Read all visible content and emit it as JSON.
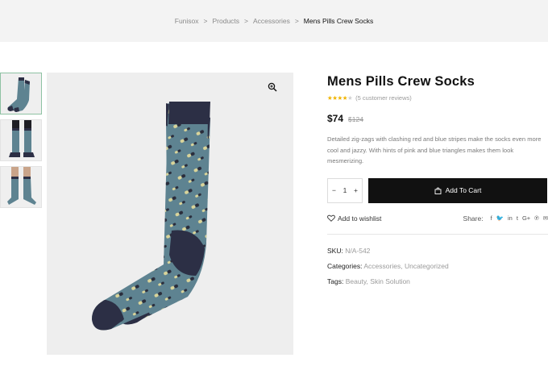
{
  "breadcrumb": {
    "items": [
      "Funisox",
      "Products",
      "Accessories"
    ],
    "current": "Mens Pills Crew Socks",
    "separator": ">"
  },
  "gallery": {
    "thumbnails": [
      "thumbnail-socks-flat",
      "thumbnail-socks-worn-front",
      "thumbnail-socks-worn-side"
    ],
    "active_index": 0,
    "zoom_icon": "zoom-in-icon"
  },
  "product": {
    "title": "Mens Pills Crew Socks",
    "rating_value": 3.5,
    "rating_max": 5,
    "reviews_text": "(5 customer reviews)",
    "price": "$74",
    "old_price": "$124",
    "description": "Detailed zig-zags with clashing red and blue stripes make the socks even more cool and jazzy. With hints of pink and blue triangles makes them look mesmerizing.",
    "qty_minus": "−",
    "qty_value": "1",
    "qty_plus": "+",
    "add_to_cart": "Add To Cart",
    "wishlist": "Add to wishlist",
    "share_label": "Share:",
    "share_icons": [
      "facebook-icon",
      "twitter-icon",
      "linkedin-icon",
      "tumblr-icon",
      "google-plus-icon",
      "pinterest-icon",
      "email-icon"
    ],
    "sku_label": "SKU:",
    "sku_value": "N/A-542",
    "categories_label": "Categories:",
    "categories": [
      "Accessories",
      "Uncategorized"
    ],
    "tags_label": "Tags:",
    "tags": [
      "Beauty",
      "Skin Solution"
    ]
  },
  "colors": {
    "sock_body": "#5e8391",
    "sock_cuff": "#2c2f45",
    "pill_light": "#d9d49a",
    "pill_dark": "#2a2d3c",
    "star": "#f0b400",
    "button": "#111111"
  }
}
